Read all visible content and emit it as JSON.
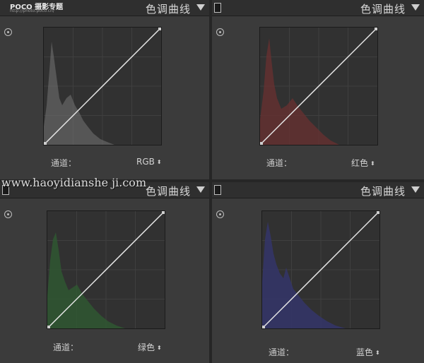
{
  "logo": {
    "brand": "POCO 摄影专题",
    "url": "http://photo.poco.cn/"
  },
  "watermark": "www.haoyidianshe ji.com",
  "panels": [
    {
      "title": "色调曲线",
      "channel_label": "通道：",
      "channel_value": "RGB",
      "hist_color": "#707070"
    },
    {
      "title": "色调曲线",
      "channel_label": "通道：",
      "channel_value": "红色",
      "hist_color": "#6a3030"
    },
    {
      "title": "色调曲线",
      "channel_label": "通道：",
      "channel_value": "绿色",
      "hist_color": "#2f5a32"
    },
    {
      "title": "色调曲线",
      "channel_label": "通道：",
      "channel_value": "蓝色",
      "hist_color": "#34356a"
    }
  ]
}
